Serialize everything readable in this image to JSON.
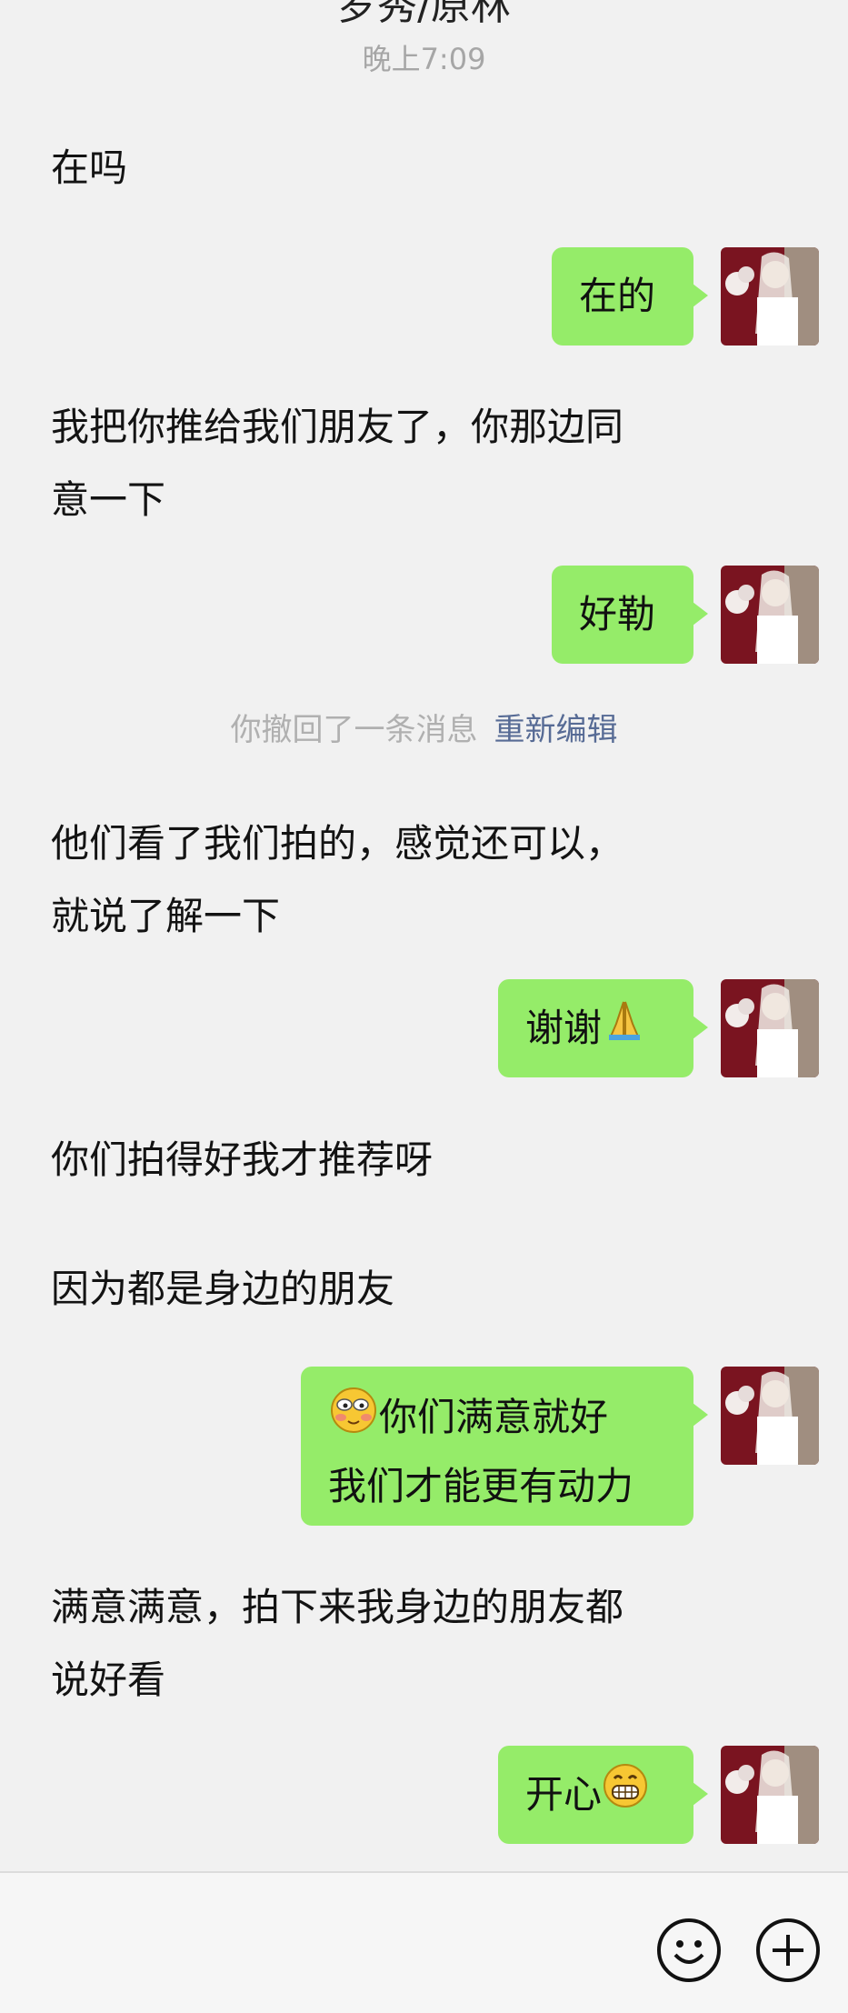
{
  "header": {
    "title": "罗秀/原林",
    "time": "晚上7:09"
  },
  "messages": {
    "m1": "在吗",
    "m2": "在的",
    "m3_line1": "我把你推给我们朋友了，你那边同",
    "m3_line2": "意一下",
    "m4": "好勒",
    "recall_text": "你撤回了一条消息",
    "recall_edit": "重新编辑",
    "m5_line1": "他们看了我们拍的，感觉还可以，",
    "m5_line2": "就说了解一下",
    "m6": "谢谢",
    "m7": "你们拍得好我才推荐呀",
    "m8": "因为都是身边的朋友",
    "m9_line1": "你们满意就好",
    "m9_line2": "我们才能更有动力",
    "m10_line1": "满意满意，拍下来我身边的朋友都",
    "m10_line2": "说好看",
    "m11": "开心"
  },
  "icons": {
    "pray": "pray-emoji",
    "blush": "blush-emoji",
    "grin": "grin-emoji",
    "emoji_button": "smiley-icon",
    "plus_button": "plus-icon"
  },
  "colors": {
    "bubble": "#95ec69",
    "link": "#576b95",
    "background": "#f1f1f1"
  }
}
